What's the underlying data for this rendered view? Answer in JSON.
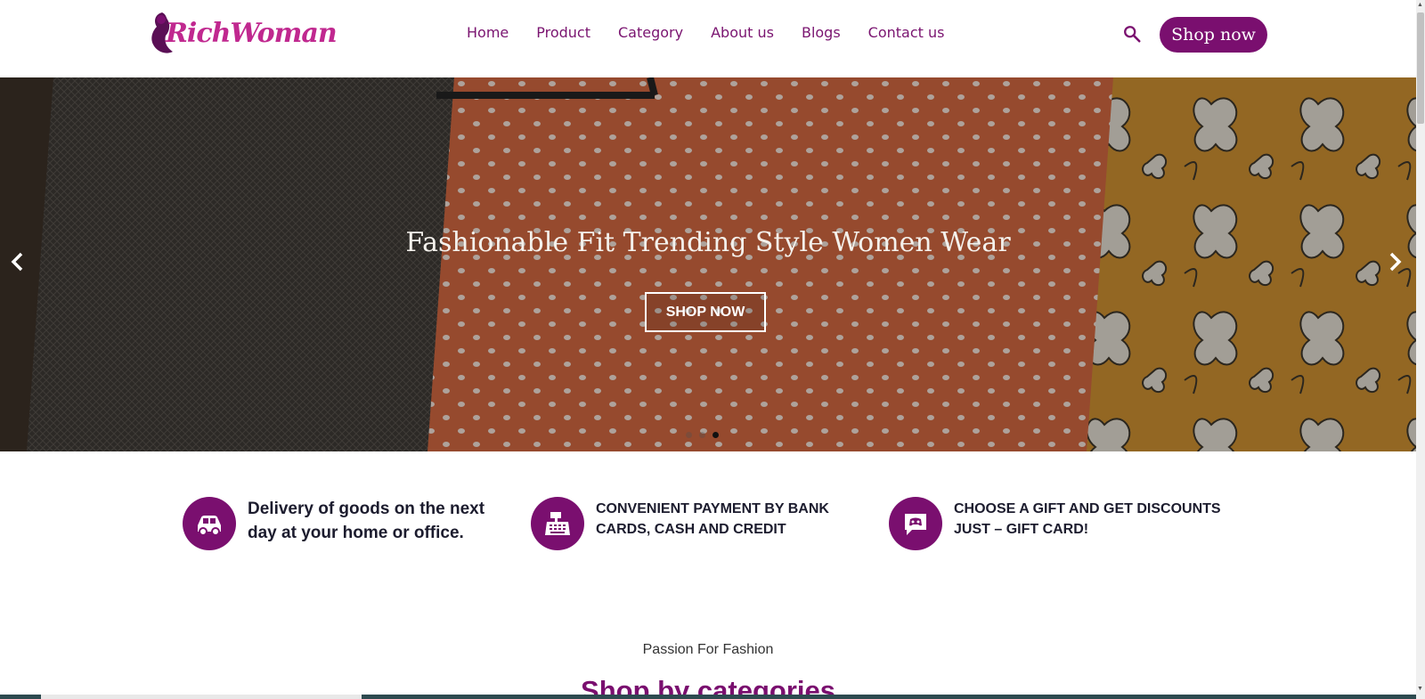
{
  "header": {
    "logo_text": "RichWoman",
    "nav": [
      "Home",
      "Product",
      "Category",
      "About us",
      "Blogs",
      "Contact us"
    ],
    "search_icon": "search-icon",
    "shop_button": "Shop now",
    "accent_color": "#7a0f6f"
  },
  "hero": {
    "title": "Fashionable Fit Trending Style Women Wear",
    "button": "SHOP NOW",
    "prev_icon": "chevron-left-icon",
    "next_icon": "chevron-right-icon",
    "slide_count": 3,
    "active_slide": 3
  },
  "features": [
    {
      "icon": "car-icon",
      "text": "Delivery of goods on the next day at your home or office."
    },
    {
      "icon": "cash-register-icon",
      "text": "CONVENIENT PAYMENT BY BANK CARDS, CASH AND CREDIT"
    },
    {
      "icon": "gift-chat-icon",
      "text": "CHOOSE A GIFT AND GET DISCOUNTS JUST – GIFT CARD!"
    }
  ],
  "section": {
    "tagline": "Passion For Fashion",
    "title": "Shop by categories"
  }
}
